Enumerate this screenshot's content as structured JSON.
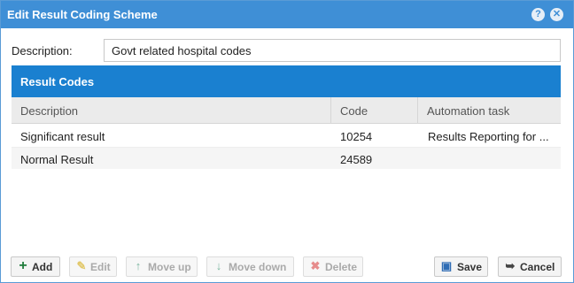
{
  "dialog": {
    "title": "Edit Result Coding Scheme",
    "help_icon": "help-icon",
    "close_icon": "close-icon"
  },
  "form": {
    "description_label": "Description:",
    "description_value": "Govt related hospital codes"
  },
  "panel": {
    "title": "Result Codes",
    "columns": [
      "Description",
      "Code",
      "Automation task"
    ],
    "rows": [
      {
        "description": "Significant result",
        "code": "10254",
        "automation": "Results Reporting for ..."
      },
      {
        "description": "Normal Result",
        "code": "24589",
        "automation": ""
      }
    ]
  },
  "toolbar": {
    "add": "Add",
    "edit": "Edit",
    "move_up": "Move up",
    "move_down": "Move down",
    "delete": "Delete",
    "save": "Save",
    "cancel": "Cancel"
  },
  "colors": {
    "titlebar": "#3f8fd6",
    "panel_header": "#1a80d0",
    "add_icon": "#1e7b3a"
  }
}
